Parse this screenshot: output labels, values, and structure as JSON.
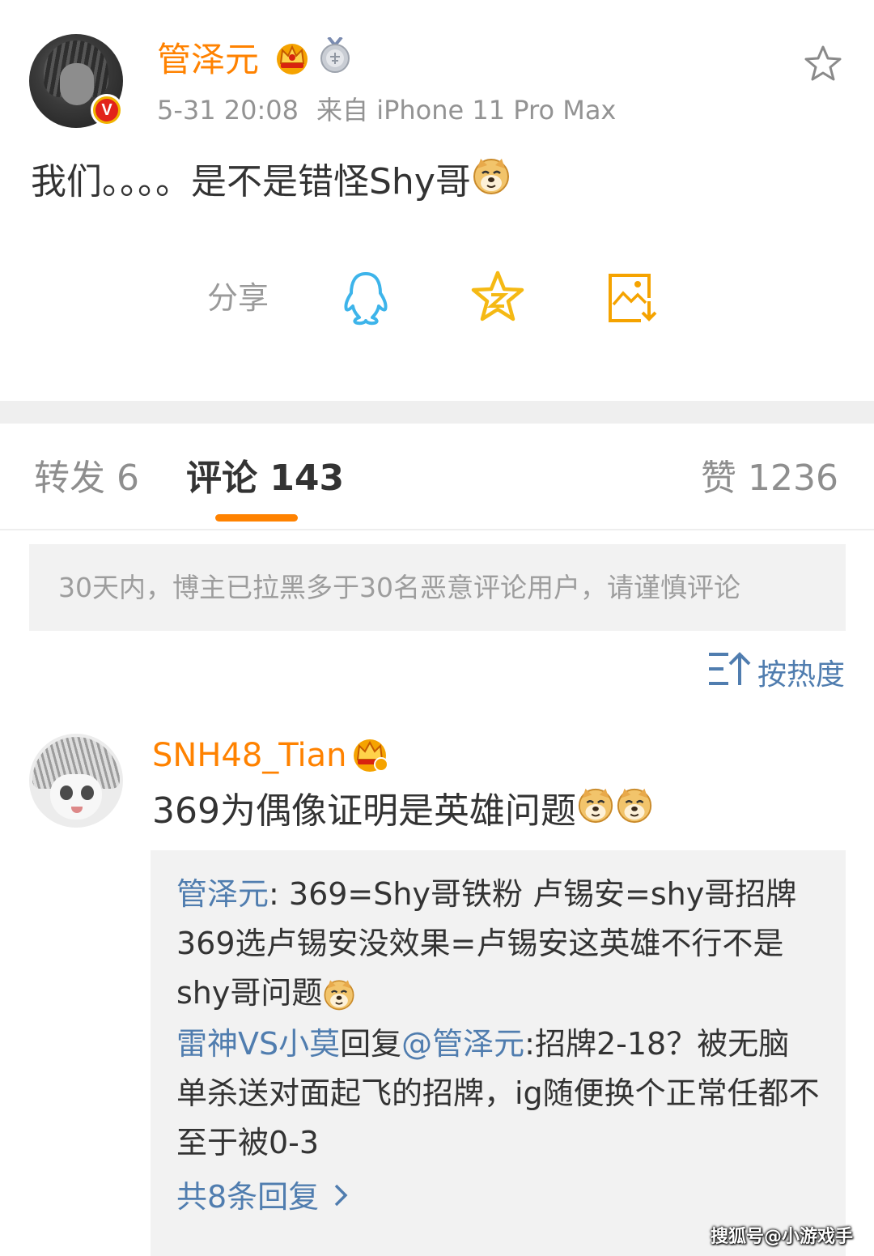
{
  "post": {
    "author": "管泽元",
    "timestamp": "5-31 20:08",
    "source": "来自 iPhone 11 Pro Max",
    "text": "我们。。。。是不是错怪Shy哥",
    "badges": [
      "crown-vip-icon",
      "medal-icon"
    ],
    "verified_mark": "V"
  },
  "share": {
    "label": "分享",
    "icons": [
      "qq-icon",
      "qzone-star-icon",
      "save-image-icon"
    ]
  },
  "tabs": {
    "repost": "转发 6",
    "comments": "评论 143",
    "likes": "赞 1236",
    "active": "comments"
  },
  "notice": "30天内，博主已拉黑多于30名恶意评论用户，请谨慎评论",
  "sort_label": "按热度",
  "comment": {
    "author": "SNH48_Tian",
    "text": "369为偶像证明是英雄问题",
    "emoji_count": 2,
    "replies": [
      {
        "name": "管泽元",
        "text": ": 369=Shy哥铁粉 卢锡安=shy哥招牌 369选卢锡安没效果=卢锡安这英雄不行不是shy哥问题"
      },
      {
        "name": "雷神VS小莫",
        "mid": "回复",
        "mention": "@管泽元",
        "text": ":招牌2-18？被无脑单杀送对面起飞的招牌，ig随便换个正常任都不至于被0-3"
      }
    ],
    "more": "共8条回复"
  },
  "watermark": "搜狐号@小游戏手",
  "colors": {
    "accent": "#ff8200",
    "link": "#507daf",
    "muted": "#939393",
    "text": "#333333",
    "notice_bg": "#f2f2f2"
  }
}
